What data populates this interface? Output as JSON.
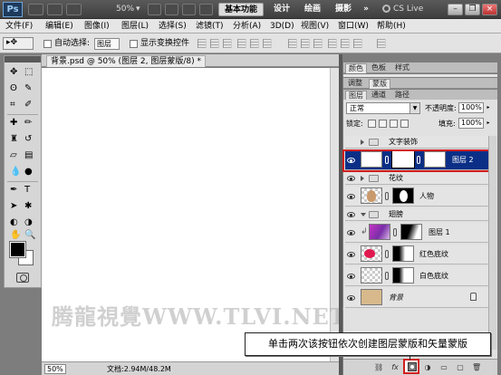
{
  "titlebar": {
    "app_logo": "Ps",
    "zoom": "50%",
    "workspaces": [
      "基本功能",
      "设计",
      "绘画",
      "摄影"
    ],
    "more": "»",
    "cs_live": "CS Live",
    "window_buttons": [
      "minimize-icon",
      "restore-icon",
      "close-icon"
    ]
  },
  "menu": [
    "文件(F)",
    "编辑(E)",
    "图像(I)",
    "图层(L)",
    "选择(S)",
    "滤镜(T)",
    "分析(A)",
    "3D(D)",
    "视图(V)",
    "窗口(W)",
    "帮助(H)"
  ],
  "options": {
    "auto_select_label": "自动选择:",
    "auto_select_value": "图层",
    "show_transform_label": "显示变换控件"
  },
  "document": {
    "tab_title": "背景.psd @ 50% (图层 2, 图层蒙版/8) *",
    "zoom": "50%",
    "info": "文档:2.94M/48.2M"
  },
  "watermark": "腾龍視覺WWW.TLVI.NET",
  "panels": {
    "top_tabs": [
      "颜色",
      "色板",
      "样式"
    ],
    "mid_tabs": [
      "调整",
      "蒙版"
    ],
    "layer_tabs": [
      "图层",
      "通道",
      "路径"
    ]
  },
  "layers_panel": {
    "blend_mode": "正常",
    "opacity_label": "不透明度:",
    "opacity": "100%",
    "lock_label": "锁定:",
    "fill_label": "填充:",
    "fill": "100%",
    "layers": [
      {
        "name": "文字装饰",
        "kind": "group",
        "expanded": false,
        "visible": false
      },
      {
        "name": "图层 2",
        "kind": "masked",
        "selected": true,
        "visible": true
      },
      {
        "name": "花纹",
        "kind": "group",
        "expanded": false,
        "visible": true
      },
      {
        "name": "人物",
        "kind": "masked",
        "visible": true
      },
      {
        "name": "翅膀",
        "kind": "group",
        "expanded": true,
        "visible": true
      },
      {
        "name": "图层 1",
        "kind": "clipped-masked",
        "visible": true
      },
      {
        "name": "红色底纹",
        "kind": "masked",
        "visible": true
      },
      {
        "name": "白色底纹",
        "kind": "masked",
        "visible": true
      },
      {
        "name": "背景",
        "kind": "background",
        "visible": true
      }
    ],
    "footer_icons": [
      "link-layers-icon",
      "fx-icon",
      "add-mask-icon",
      "adjustment-layer-icon",
      "new-group-icon",
      "new-layer-icon",
      "trash-icon"
    ]
  },
  "tooltip": "单击两次该按钮依次创建图层蒙版和矢量蒙版",
  "colors": {
    "selection": "#0b2f86",
    "highlight": "#d21e1e",
    "foreground": "#000000",
    "background": "#ffffff"
  }
}
